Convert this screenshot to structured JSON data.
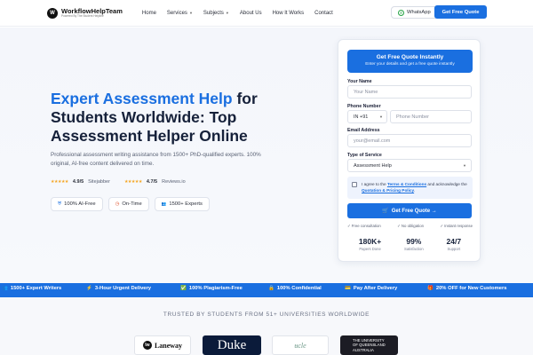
{
  "nav": {
    "logo_mark": "W",
    "logo_title": "WorkflowHelpTeam",
    "logo_sub": "Powered By The Student Helpline",
    "links": [
      "Home",
      "Services",
      "Subjects",
      "About Us",
      "How It Works",
      "Contact"
    ],
    "whatsapp": "WhatsApp",
    "quote_button": "Get Free Quote"
  },
  "hero": {
    "title_blue": "Expert Assessment Help",
    "title_rest": " for Students Worldwide: Top Assessment Helper Online",
    "description": "Professional assessment writing assistance from 1500+ PhD-qualified experts. 100% original, AI-free content delivered on time.",
    "ratings": [
      {
        "stars": "★★★★★",
        "value": "4.9/5",
        "source": "Sitejabber"
      },
      {
        "stars": "★★★★★",
        "value": "4.7/5",
        "source": "Reviews.io"
      }
    ],
    "badges": [
      {
        "icon": "shield-icon",
        "glyph": "⛨",
        "label": "100% AI-Free"
      },
      {
        "icon": "clock-icon",
        "glyph": "◷",
        "label": "On-Time"
      },
      {
        "icon": "users-icon",
        "glyph": "👥",
        "label": "1500+ Experts"
      }
    ]
  },
  "form": {
    "header_title": "Get Free Quote Instantly",
    "header_sub": "Enter your details and get a free quote instantly",
    "name_label": "Your Name",
    "name_placeholder": "Your Name",
    "phone_label": "Phone Number",
    "phone_code": "IN +91",
    "phone_placeholder": "Phone Number",
    "email_label": "Email Address",
    "email_placeholder": "your@email.com",
    "service_label": "Type of Service",
    "service_value": "Assessment Help",
    "agree_pre": "I agree to the ",
    "agree_link1": "Terms & Conditions",
    "agree_mid": " and acknowledge the ",
    "agree_link2": "Quotation & Pricing Policy",
    "agree_end": ".",
    "submit": "Get Free Quote →",
    "perks": [
      "✓ Free consultation",
      "✓ No obligation",
      "✓ Instant response"
    ],
    "stats": [
      {
        "value": "180K+",
        "label": "Papers Done"
      },
      {
        "value": "99%",
        "label": "Satisfaction"
      },
      {
        "value": "24/7",
        "label": "Support"
      }
    ]
  },
  "ticker": [
    "1500+ Expert Writers",
    "3-Hour Urgent Delivery",
    "100% Plagiarism-Free",
    "100% Confidential",
    "Pay After Delivery",
    "20% OFF for New Customers"
  ],
  "trusted": {
    "title": "TRUSTED BY STUDENTS FROM 51+ UNIVERSITIES WORLDWIDE",
    "universities": {
      "laneway_mark": "lw",
      "laneway": "Laneway",
      "duke": "Duke",
      "ucl": "ʉcle",
      "uq_line1": "THE UNIVERSITY",
      "uq_line2": "OF QUEENSLAND",
      "uq_line3": "AUSTRALIA"
    }
  },
  "colors": {
    "accent": "#1a6fe0",
    "dark": "#16213a",
    "star": "#f5a623"
  }
}
